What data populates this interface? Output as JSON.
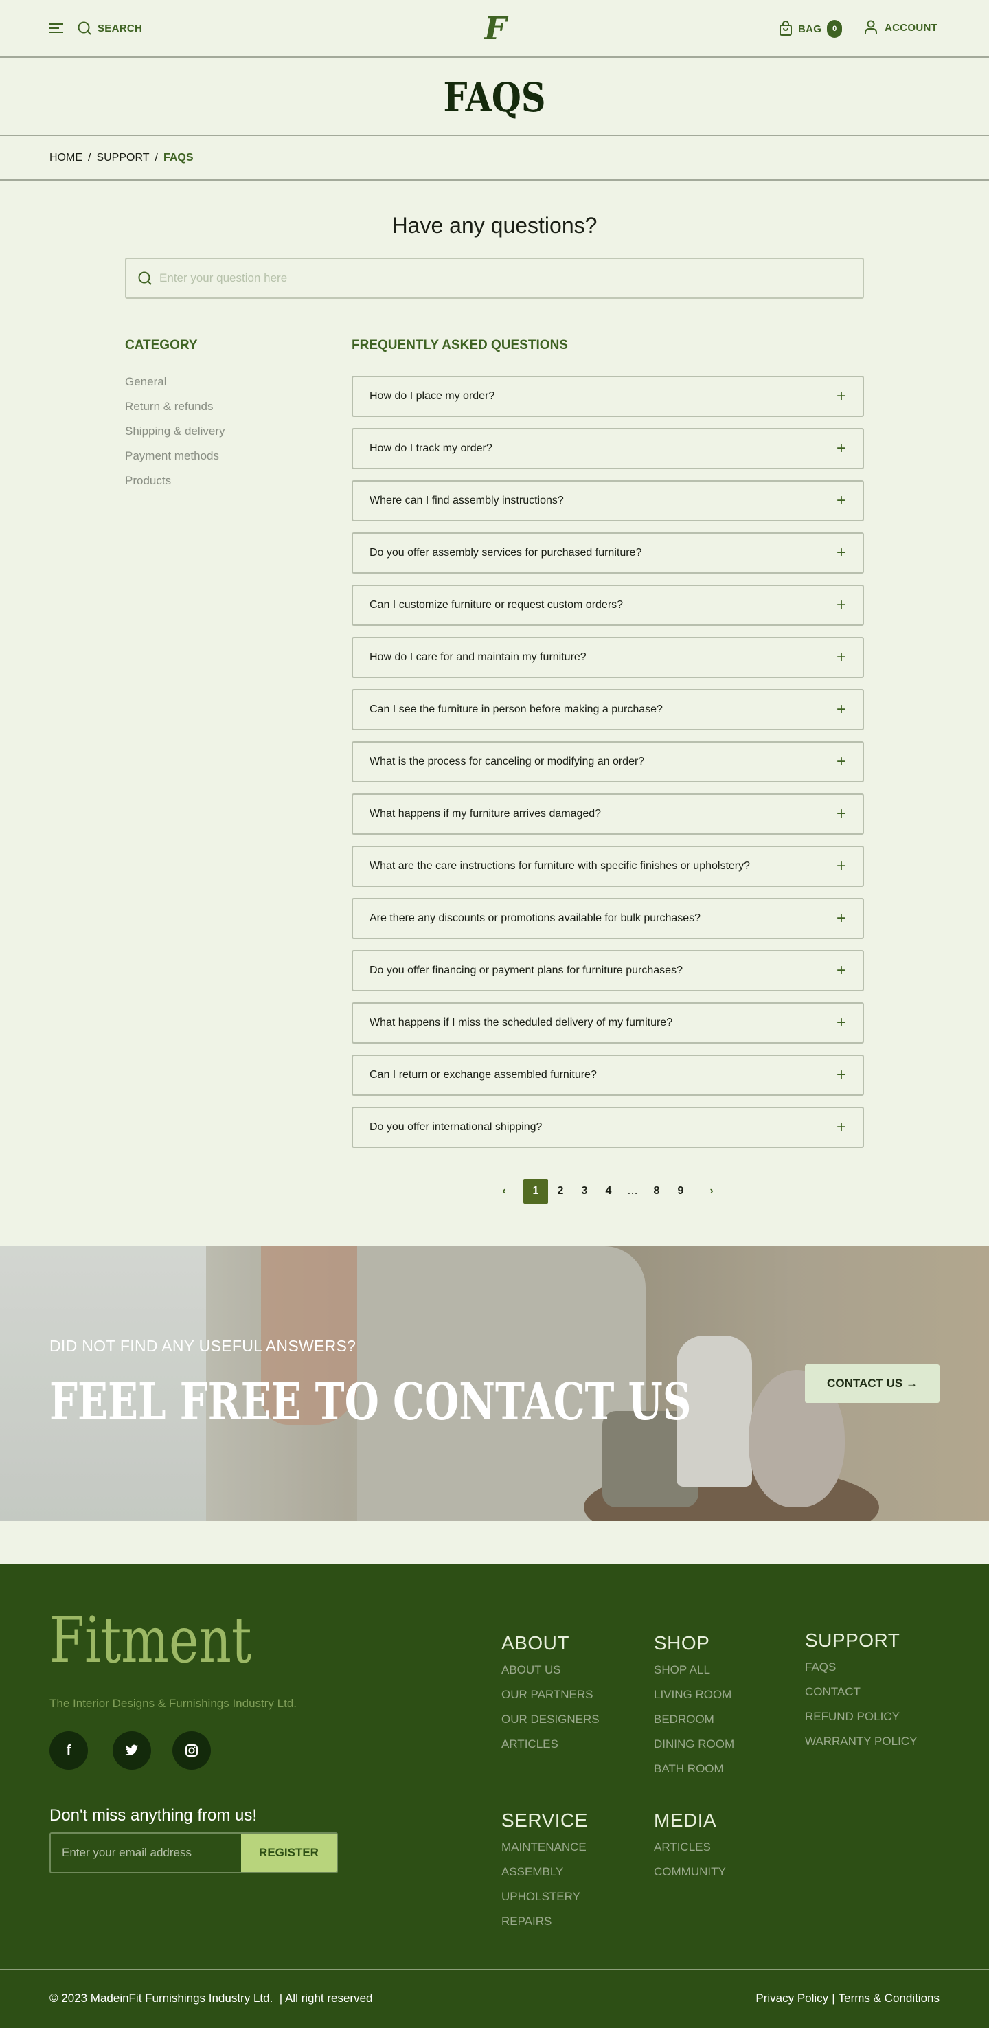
{
  "header": {
    "search_label": "SEARCH",
    "logo_letter": "F",
    "bag_label": "BAG",
    "bag_count": "0",
    "account_label": "ACCOUNT"
  },
  "page_title": "FAQS",
  "breadcrumb": {
    "items": [
      "HOME",
      "SUPPORT",
      "FAQS"
    ],
    "separator": "/"
  },
  "search": {
    "heading": "Have any questions?",
    "placeholder": "Enter your question here"
  },
  "category": {
    "title": "CATEGORY",
    "items": [
      "General",
      "Return & refunds",
      "Shipping & delivery",
      "Payment methods",
      "Products"
    ]
  },
  "faq": {
    "title": "FREQUENTLY ASKED QUESTIONS",
    "items": [
      "How do I place my order?",
      "How do I track my order?",
      "Where can I find assembly instructions?",
      "Do you offer assembly services for purchased furniture?",
      "Can I customize furniture or request custom orders?",
      "How do I care for and maintain my furniture?",
      "Can I see the furniture in person before making a purchase?",
      "What is the process for canceling or modifying an order?",
      "What happens if my furniture arrives damaged?",
      "What are the care instructions for furniture with specific finishes or upholstery?",
      "Are there any discounts or promotions available for bulk purchases?",
      "Do you offer financing or payment plans for furniture purchases?",
      "What happens if I miss the scheduled delivery of my furniture?",
      "Can I return or exchange assembled furniture?",
      "Do you offer international shipping?"
    ],
    "expand_glyph": "+"
  },
  "pagination": {
    "prev": "‹",
    "next": "›",
    "pages": [
      "1",
      "2",
      "3",
      "4",
      "…",
      "8",
      "9"
    ],
    "current": "1"
  },
  "banner": {
    "subtitle": "DID NOT FIND ANY USEFUL ANSWERS?",
    "title": "FEEL FREE TO CONTACT US",
    "button": "CONTACT US →"
  },
  "footer": {
    "logo": "Fitment",
    "tagline": "The Interior Designs & Furnishings Industry Ltd.",
    "social": [
      "facebook-icon",
      "twitter-icon",
      "instagram-icon"
    ],
    "newsletter": {
      "title": "Don't miss anything from us!",
      "placeholder": "Enter your email address",
      "button": "REGISTER"
    },
    "columns": [
      {
        "title": "ABOUT",
        "items": [
          "ABOUT US",
          "OUR PARTNERS",
          "OUR DESIGNERS",
          "ARTICLES"
        ]
      },
      {
        "title": "SHOP",
        "items": [
          "SHOP ALL",
          "LIVING ROOM",
          "BEDROOM",
          "DINING ROOM",
          "BATH ROOM"
        ]
      },
      {
        "title": "SUPPORT",
        "items": [
          "FAQS",
          "CONTACT",
          "REFUND POLICY",
          "WARRANTY POLICY"
        ]
      },
      {
        "title": "SERVICE",
        "items": [
          "MAINTENANCE",
          "ASSEMBLY",
          "UPHOLSTERY",
          "REPAIRS"
        ]
      },
      {
        "title": "MEDIA",
        "items": [
          "ARTICLES",
          "COMMUNITY"
        ]
      }
    ],
    "copyright": "© 2023 MadeinFit Furnishings Industry Ltd.  | All right reserved",
    "privacy": "Privacy Policy",
    "terms": "Terms & Conditions"
  },
  "colors": {
    "background": "#eff3e6",
    "accent": "#3f6323",
    "footer": "#2d4f15",
    "active_page": "#526b22",
    "register": "#b8d47c",
    "logo": "#9cb865"
  }
}
